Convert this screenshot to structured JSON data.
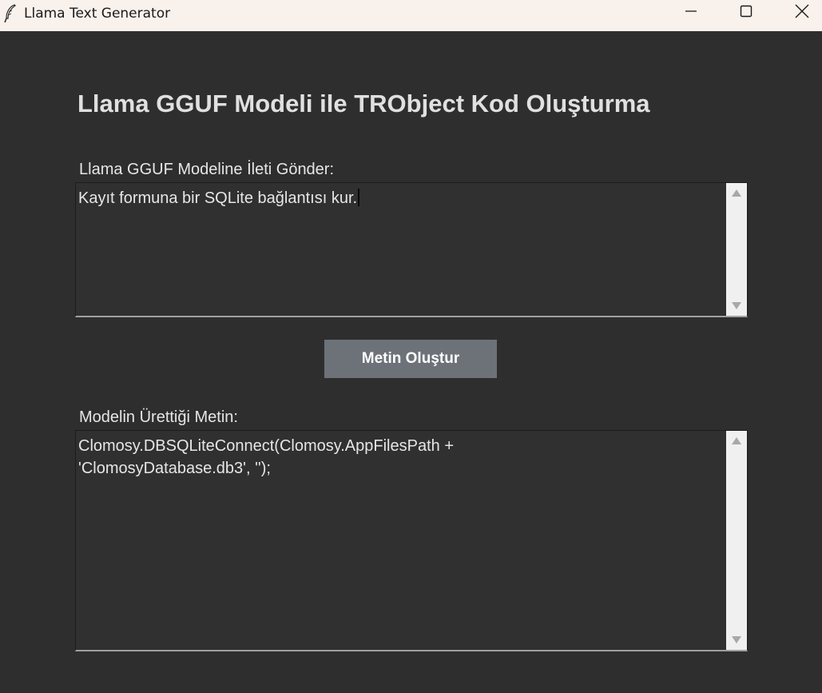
{
  "window": {
    "title": "Llama Text Generator",
    "icon": "feather-icon",
    "controls": [
      "minimize-icon",
      "maximize-icon",
      "close-icon"
    ]
  },
  "main": {
    "heading": "Llama GGUF Modeli ile TRObject Kod Oluşturma",
    "prompt_label": "Llama GGUF Modeline İleti Gönder:",
    "prompt_value": "Kayıt formuna bir SQLite bağlantısı kur.",
    "generate_button_label": "Metin Oluştur",
    "output_label": "Modelin Ürettiği Metin:",
    "output_value": "Clomosy.DBSQLiteConnect(Clomosy.AppFilesPath +\n'ClomosyDatabase.db3', '');"
  },
  "colors": {
    "background": "#2e2e2e",
    "titlebar": "#f9f1ec",
    "button": "#6d7279",
    "text": "#e6e6e6"
  }
}
